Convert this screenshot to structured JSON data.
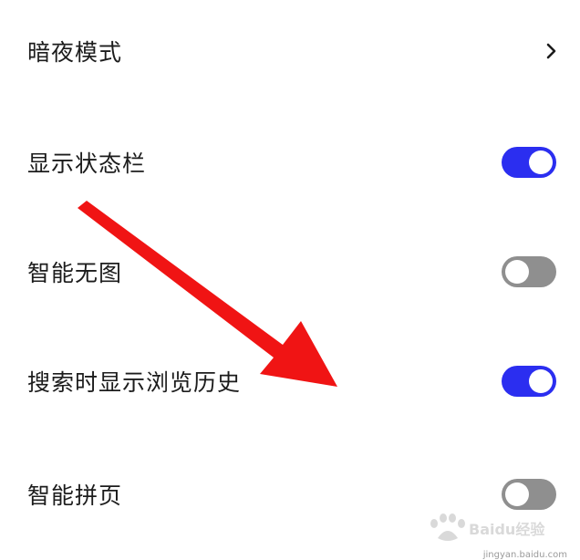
{
  "settings": {
    "dark_mode": {
      "label": "暗夜模式"
    },
    "show_status_bar": {
      "label": "显示状态栏",
      "enabled": true
    },
    "smart_no_image": {
      "label": "智能无图",
      "enabled": false
    },
    "show_history_on_search": {
      "label": "搜索时显示浏览历史",
      "enabled": true
    },
    "smart_page_join": {
      "label": "智能拼页",
      "enabled": false
    }
  },
  "icons": {
    "chevron": "chevron-right-icon",
    "annotation": "red-arrow-annotation"
  },
  "colors": {
    "toggle_on": "#2b2ef0",
    "toggle_off": "#8f8f8f",
    "arrow": "#f01414",
    "text": "#1c1c1c"
  },
  "watermark": {
    "brand": "Baidu经验",
    "url": "jingyan.baidu.com"
  }
}
